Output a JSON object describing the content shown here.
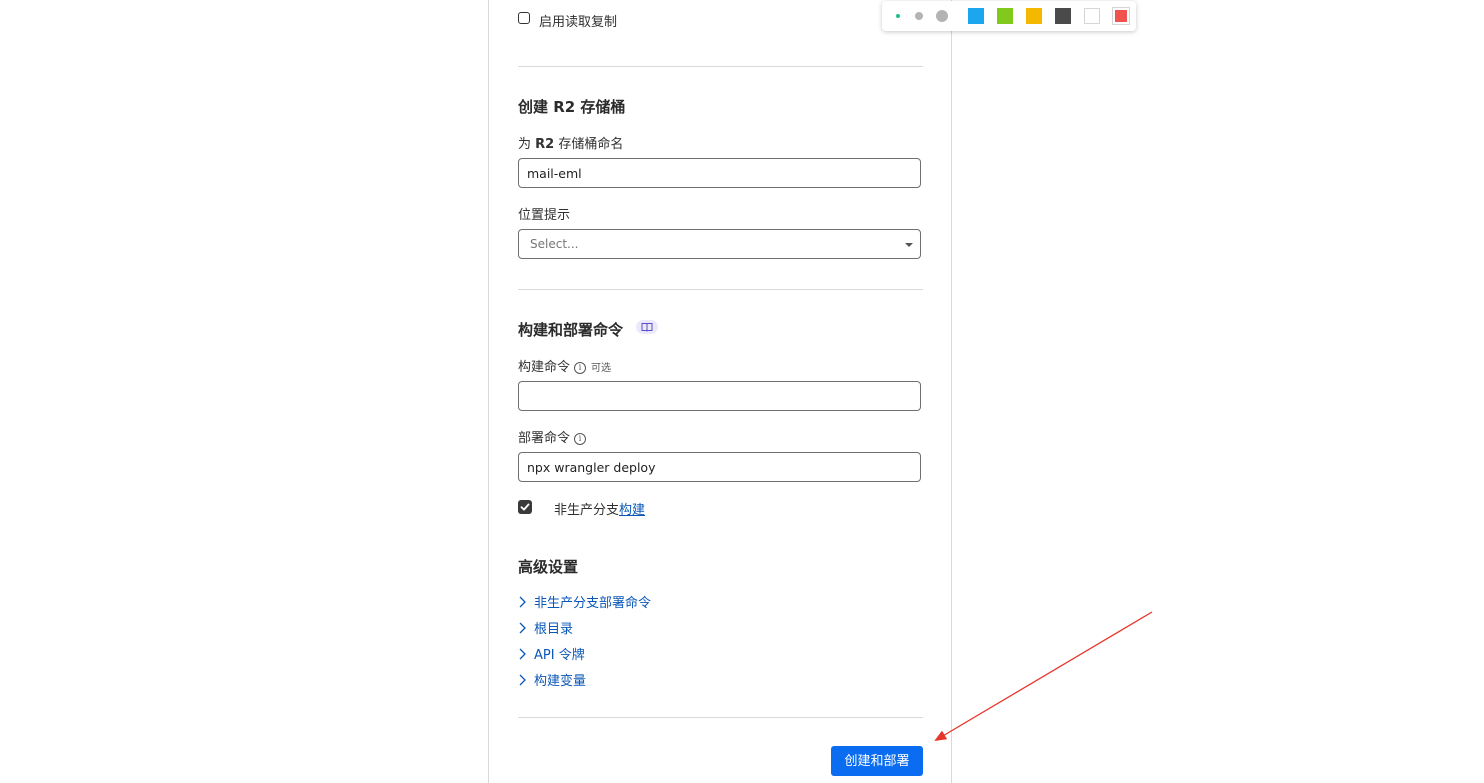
{
  "form": {
    "read_replication_label": "启用读取复制",
    "r2_section_title": "创建 R2 存储桶",
    "bucket_name_label_prefix": "为 ",
    "bucket_name_label_bold": "R2",
    "bucket_name_label_suffix": " 存储桶命名",
    "bucket_name_value": "mail-eml",
    "location_label": "位置提示",
    "location_placeholder": "Select...",
    "build_section_title": "构建和部署命令",
    "build_command_label": "构建命令",
    "build_command_optional": "可选",
    "build_command_value": "",
    "deploy_command_label": "部署命令",
    "deploy_command_value": "npx wrangler deploy",
    "non_prod_label_prefix": "非生产分支",
    "non_prod_label_link": "构建",
    "advanced_title": "高级设置",
    "advanced_items": [
      "非生产分支部署命令",
      "根目录",
      "API 令牌",
      "构建变量"
    ],
    "submit_label": "创建和部署"
  },
  "annotation_toolbar": {
    "pen_sizes": [
      "small",
      "medium",
      "large"
    ],
    "colors": [
      "#1aa7ef",
      "#82c91e",
      "#f5b800",
      "#4a4a4a",
      "#ffffff",
      "#f0524f"
    ],
    "selected_color": "#f0524f",
    "selected_size": "small",
    "size_dot_color": "#1fbf8f"
  },
  "annotation": {
    "arrow_color": "#e8352a"
  }
}
